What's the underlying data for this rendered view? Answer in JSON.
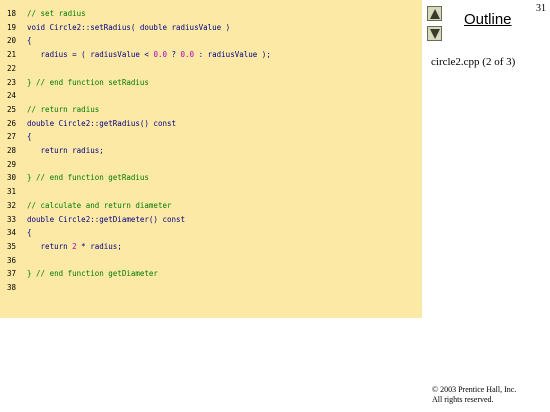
{
  "slide": {
    "page_number": "31",
    "outline_label": "Outline",
    "file_label": "circle2.cpp (2 of 3)",
    "copyright_line1": "© 2003 Prentice Hall, Inc.",
    "copyright_line2": "All rights reserved."
  },
  "nav": {
    "prev_icon": "triangle-up-icon",
    "next_icon": "triangle-down-icon"
  },
  "code": {
    "lines": [
      {
        "n": "18",
        "t": [
          [
            "cm",
            "// set radius"
          ]
        ]
      },
      {
        "n": "19",
        "t": [
          [
            "kw",
            "void Circle2::setRadius( double radiusValue )"
          ]
        ]
      },
      {
        "n": "20",
        "t": [
          [
            "kw",
            "{"
          ]
        ]
      },
      {
        "n": "21",
        "t": [
          [
            "kw",
            "   radius = ( radiusValue < "
          ],
          [
            "num",
            "0.0"
          ],
          [
            "kw",
            " ? "
          ],
          [
            "num",
            "0.0"
          ],
          [
            "kw",
            " : radiusValue );"
          ]
        ]
      },
      {
        "n": "22",
        "t": []
      },
      {
        "n": "23",
        "t": [
          [
            "cm",
            "} // end function setRadius"
          ]
        ]
      },
      {
        "n": "24",
        "t": []
      },
      {
        "n": "25",
        "t": [
          [
            "cm",
            "// return radius"
          ]
        ]
      },
      {
        "n": "26",
        "t": [
          [
            "kw",
            "double Circle2::getRadius() const"
          ]
        ]
      },
      {
        "n": "27",
        "t": [
          [
            "kw",
            "{"
          ]
        ]
      },
      {
        "n": "28",
        "t": [
          [
            "kw",
            "   return radius;"
          ]
        ]
      },
      {
        "n": "29",
        "t": []
      },
      {
        "n": "30",
        "t": [
          [
            "cm",
            "} // end function getRadius"
          ]
        ]
      },
      {
        "n": "31",
        "t": []
      },
      {
        "n": "32",
        "t": [
          [
            "cm",
            "// calculate and return diameter"
          ]
        ]
      },
      {
        "n": "33",
        "t": [
          [
            "kw",
            "double Circle2::getDiameter() const"
          ]
        ]
      },
      {
        "n": "34",
        "t": [
          [
            "kw",
            "{"
          ]
        ]
      },
      {
        "n": "35",
        "t": [
          [
            "kw",
            "   return "
          ],
          [
            "num",
            "2"
          ],
          [
            "kw",
            " * radius;"
          ]
        ]
      },
      {
        "n": "36",
        "t": []
      },
      {
        "n": "37",
        "t": [
          [
            "cm",
            "} // end function getDiameter"
          ]
        ]
      },
      {
        "n": "38",
        "t": []
      }
    ]
  },
  "colors": {
    "code_background": "#fde9a6",
    "comment": "#007a00",
    "code_text": "#000080",
    "number": "#b000b0"
  }
}
